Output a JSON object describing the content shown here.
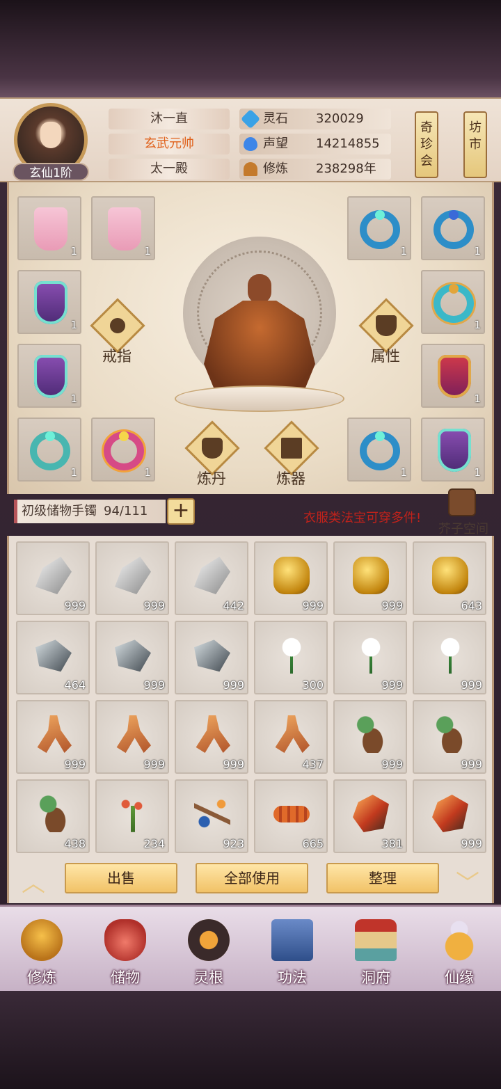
{
  "player": {
    "name": "沐一直",
    "title": "玄武元帅",
    "sect": "太一殿",
    "rank": "玄仙1阶"
  },
  "stats": [
    {
      "icon": "spirit-stone-icon",
      "label": "灵石",
      "value": "320029"
    },
    {
      "icon": "reputation-icon",
      "label": "声望",
      "value": "14214855"
    },
    {
      "icon": "cultivation-icon",
      "label": "修炼",
      "value": "238298年"
    }
  ],
  "side_buttons": {
    "treasure_hall": "奇珍会",
    "market": "坊市"
  },
  "equipment": {
    "rings_label": "戒指",
    "attributes_label": "属性",
    "alchemy_label": "炼丹",
    "forging_label": "炼器",
    "slots": [
      {
        "item": "pink-robe",
        "count": "1"
      },
      {
        "item": "pink-robe",
        "count": "1"
      },
      {
        "item": "blue-ring",
        "count": "1"
      },
      {
        "item": "blue-gem-ring",
        "count": "1"
      },
      {
        "item": "purple-robe",
        "count": "1"
      },
      {
        "item": "gold-ring",
        "count": "1"
      },
      {
        "item": "purple-robe",
        "count": "1"
      },
      {
        "item": "red-armor",
        "count": "1"
      },
      {
        "item": "teal-ring",
        "count": "1"
      },
      {
        "item": "pink-ring",
        "count": "1"
      },
      {
        "item": "blue-ring",
        "count": "1"
      },
      {
        "item": "purple-robe",
        "count": "1"
      }
    ]
  },
  "bag": {
    "name": "初级储物手镯",
    "capacity": "94/111",
    "expand_label": "+",
    "notice": "衣服类法宝可穿多件!",
    "space_label": "芥子空间"
  },
  "inventory": [
    {
      "item": "silver-ore",
      "count": "999"
    },
    {
      "item": "silver-ore",
      "count": "999"
    },
    {
      "item": "silver-ore",
      "count": "442"
    },
    {
      "item": "gold-ore",
      "count": "999"
    },
    {
      "item": "gold-ore",
      "count": "999"
    },
    {
      "item": "gold-ore",
      "count": "643"
    },
    {
      "item": "iron-ore",
      "count": "464"
    },
    {
      "item": "iron-ore",
      "count": "999"
    },
    {
      "item": "iron-ore",
      "count": "999"
    },
    {
      "item": "white-lily",
      "count": "300"
    },
    {
      "item": "white-lily",
      "count": "999"
    },
    {
      "item": "white-lily",
      "count": "999"
    },
    {
      "item": "ginseng-root",
      "count": "999"
    },
    {
      "item": "ginseng-root",
      "count": "999"
    },
    {
      "item": "ginseng-root",
      "count": "999"
    },
    {
      "item": "ginseng-root",
      "count": "437"
    },
    {
      "item": "leaf-tuber",
      "count": "999"
    },
    {
      "item": "leaf-tuber",
      "count": "999"
    },
    {
      "item": "leaf-tuber",
      "count": "438"
    },
    {
      "item": "red-flower-herb",
      "count": "234"
    },
    {
      "item": "berry-branch",
      "count": "923"
    },
    {
      "item": "cordyceps",
      "count": "665"
    },
    {
      "item": "fire-crystal",
      "count": "381"
    },
    {
      "item": "fire-crystal",
      "count": "999"
    }
  ],
  "actions": {
    "sell": "出售",
    "use_all": "全部使用",
    "sort": "整理"
  },
  "nav": [
    {
      "icon": "cultivate-icon",
      "label": "修炼"
    },
    {
      "icon": "storage-bag-icon",
      "label": "储物"
    },
    {
      "icon": "spirit-root-icon",
      "label": "灵根"
    },
    {
      "icon": "technique-book-icon",
      "label": "功法"
    },
    {
      "icon": "cave-dwelling-icon",
      "label": "洞府"
    },
    {
      "icon": "fortune-gourd-icon",
      "label": "仙缘"
    }
  ],
  "colors": {
    "notice": "#c0221b",
    "button": "#f1c267",
    "capacity_bar": "#b6555a"
  }
}
